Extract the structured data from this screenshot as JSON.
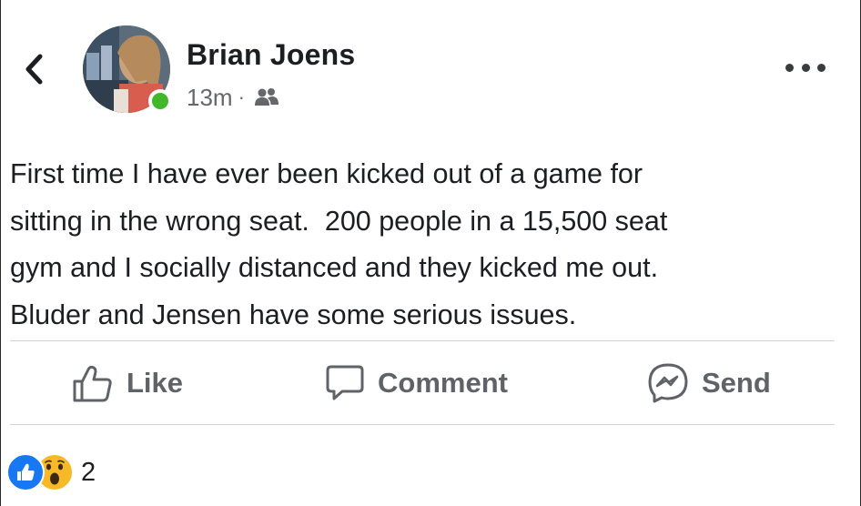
{
  "post": {
    "author": "Brian Joens",
    "timestamp": "13m",
    "separator": "·",
    "audience_icon": "friends-icon",
    "text": "First time I have ever been kicked out of a game for\nsitting in the wrong seat.  200 people in a 15,500 seat\ngym and I socially distanced and they kicked me out.\nBluder and Jensen have some serious issues."
  },
  "header": {
    "back_icon": "chevron-left-icon",
    "more_icon": "more-horizontal-icon",
    "online_status_color": "#42b72a"
  },
  "actions": {
    "like_label": "Like",
    "comment_label": "Comment",
    "send_label": "Send"
  },
  "reactions": {
    "types": [
      "like",
      "wow"
    ],
    "count": "2",
    "like_color": "#1877f2",
    "wow_color": "#f7b928"
  }
}
